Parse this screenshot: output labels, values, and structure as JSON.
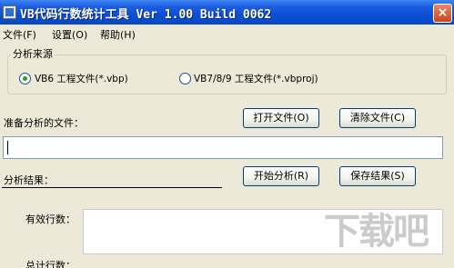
{
  "window": {
    "title": "VB代码行数统计工具 Ver 1.00 Build 0062",
    "close_glyph": "×"
  },
  "menu": {
    "items": [
      {
        "label": "文件(F)"
      },
      {
        "label": "设置(O)"
      },
      {
        "label": "帮助(H)"
      }
    ]
  },
  "source_group": {
    "label": "分析来源",
    "options": [
      {
        "label": "VB6 工程文件(*.vbp)",
        "checked": true
      },
      {
        "label": "VB7/8/9 工程文件(*.vbproj)",
        "checked": false
      }
    ]
  },
  "file_section": {
    "label": "准备分析的文件：",
    "open_button": "打开文件(O)",
    "clear_button": "清除文件(C)",
    "file_path": ""
  },
  "result_section": {
    "label": "分析结果：",
    "start_button": "开始分析(R)",
    "save_button": "保存结果(S)",
    "effective_lines_label": "有效行数：",
    "total_lines_label": "总计行数："
  },
  "watermark": {
    "text": "下载吧"
  },
  "colors": {
    "titlebar": "#0a4fd6",
    "dialog_bg": "#ece9d8",
    "radio_dot": "#21a121",
    "button_border": "#003c74"
  }
}
